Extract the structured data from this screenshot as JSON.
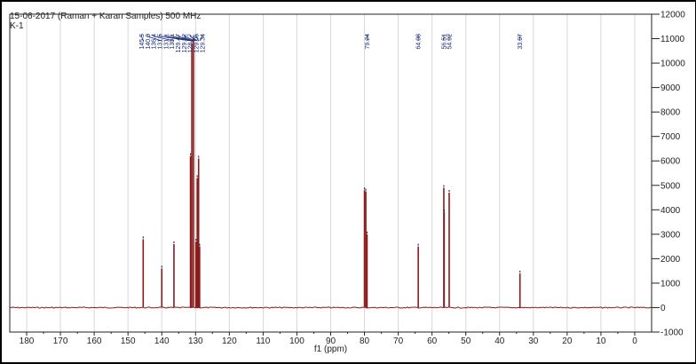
{
  "chart_data": {
    "type": "line",
    "title": "15-06-2017 (Raman + Karan Samples) 500 MHz",
    "subtitle": "K-1",
    "xlabel": "f1 (ppm)",
    "ylabel": "",
    "xlim": [
      185,
      -5
    ],
    "ylim": [
      -1000,
      12000
    ],
    "x_reversed": true,
    "grid": true,
    "x_ticks": [
      180,
      170,
      160,
      150,
      140,
      130,
      120,
      110,
      100,
      90,
      80,
      70,
      60,
      50,
      40,
      30,
      20,
      10,
      0
    ],
    "y_ticks": [
      12000,
      11000,
      10000,
      9000,
      8000,
      7000,
      6000,
      5000,
      4000,
      3000,
      2000,
      1000,
      0,
      -1000
    ],
    "y_tick_labels": [
      "12000",
      "11000",
      "10000",
      "9000",
      "8000",
      "7000",
      "6000",
      "5000",
      "4000",
      "3000",
      "2000",
      "1000",
      "0",
      "-1000"
    ],
    "peak_labels": [
      "145.5",
      "140.0",
      "136.4",
      "131.5",
      "131.1",
      "130.1",
      "129.47",
      "129.52",
      "128.77",
      "129.05",
      "129.34",
      "79.24",
      "64.08",
      "56.51",
      "54.92",
      "33.97"
    ],
    "peaks": [
      {
        "ppm": 145.5,
        "intensity": 2800
      },
      {
        "ppm": 140.0,
        "intensity": 1600
      },
      {
        "ppm": 136.4,
        "intensity": 2600
      },
      {
        "ppm": 131.5,
        "intensity": 6200
      },
      {
        "ppm": 131.1,
        "intensity": 10800
      },
      {
        "ppm": 130.6,
        "intensity": 11000
      },
      {
        "ppm": 129.9,
        "intensity": 2700
      },
      {
        "ppm": 129.5,
        "intensity": 5300
      },
      {
        "ppm": 129.1,
        "intensity": 6100
      },
      {
        "ppm": 128.8,
        "intensity": 2500
      },
      {
        "ppm": 80.0,
        "intensity": 4800
      },
      {
        "ppm": 79.6,
        "intensity": 4750
      },
      {
        "ppm": 79.24,
        "intensity": 3000
      },
      {
        "ppm": 64.08,
        "intensity": 2500
      },
      {
        "ppm": 56.51,
        "intensity": 4900
      },
      {
        "ppm": 56.4,
        "intensity": 3900
      },
      {
        "ppm": 54.92,
        "intensity": 4700
      },
      {
        "ppm": 33.97,
        "intensity": 1400
      }
    ],
    "colors": {
      "spectrum": "#8b1a1a",
      "labels": "#1a2b7a",
      "grid": "#d7d7d7",
      "axis": "#222222"
    }
  }
}
